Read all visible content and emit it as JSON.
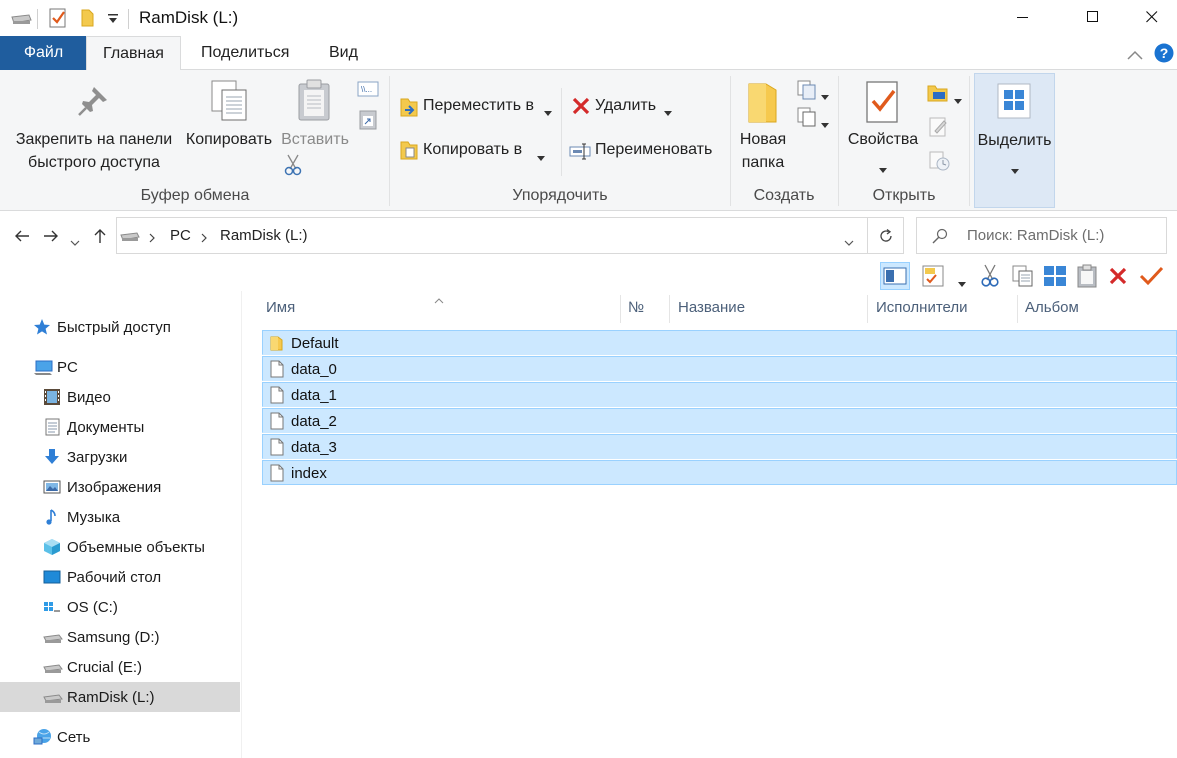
{
  "window": {
    "title": "RamDisk (L:)",
    "minimize_label": "Minimize",
    "maximize_label": "Maximize",
    "close_label": "Close"
  },
  "ribbon_tabs": [
    {
      "label": "Файл"
    },
    {
      "label": "Главная"
    },
    {
      "label": "Поделиться"
    },
    {
      "label": "Вид"
    }
  ],
  "ribbon": {
    "clipboard": {
      "group_label": "Буфер обмена",
      "pin_label_1": "Закрепить на панели",
      "pin_label_2": "быстрого доступа",
      "copy_label": "Копировать",
      "paste_label": "Вставить"
    },
    "organize": {
      "group_label": "Упорядочить",
      "move_label": "Переместить в",
      "copy_to_label": "Копировать в",
      "delete_label": "Удалить",
      "rename_label": "Переименовать"
    },
    "new": {
      "group_label": "Создать",
      "new_folder_1": "Новая",
      "new_folder_2": "папка"
    },
    "open": {
      "group_label": "Открыть",
      "properties_label": "Свойства"
    },
    "select": {
      "select_label": "Выделить"
    }
  },
  "address": {
    "crumbs": [
      "PC",
      "RamDisk (L:)"
    ],
    "search_placeholder": "Поиск: RamDisk (L:)"
  },
  "nav": {
    "quick_access": "Быстрый доступ",
    "pc": "PC",
    "items": [
      {
        "label": "Видео",
        "icon": "video-icon"
      },
      {
        "label": "Документы",
        "icon": "documents-icon"
      },
      {
        "label": "Загрузки",
        "icon": "downloads-icon"
      },
      {
        "label": "Изображения",
        "icon": "pictures-icon"
      },
      {
        "label": "Музыка",
        "icon": "music-icon"
      },
      {
        "label": "Объемные объекты",
        "icon": "3d-objects-icon"
      },
      {
        "label": "Рабочий стол",
        "icon": "desktop-icon"
      },
      {
        "label": "OS (C:)",
        "icon": "os-drive-icon"
      },
      {
        "label": "Samsung (D:)",
        "icon": "drive-icon"
      },
      {
        "label": "Crucial (E:)",
        "icon": "drive-icon"
      },
      {
        "label": "RamDisk (L:)",
        "icon": "drive-icon"
      }
    ],
    "network": "Сеть"
  },
  "columns": [
    {
      "label": "Имя"
    },
    {
      "label": "№"
    },
    {
      "label": "Название"
    },
    {
      "label": "Исполнители"
    },
    {
      "label": "Альбом"
    }
  ],
  "files": [
    {
      "name": "Default",
      "type": "folder"
    },
    {
      "name": "data_0",
      "type": "file"
    },
    {
      "name": "data_1",
      "type": "file"
    },
    {
      "name": "data_2",
      "type": "file"
    },
    {
      "name": "data_3",
      "type": "file"
    },
    {
      "name": "index",
      "type": "file"
    }
  ],
  "colors": {
    "accent": "#1f5d9e",
    "selection": "#cce8ff",
    "selection_border": "#99d1ff",
    "nav_selected": "#d9d9d9"
  }
}
